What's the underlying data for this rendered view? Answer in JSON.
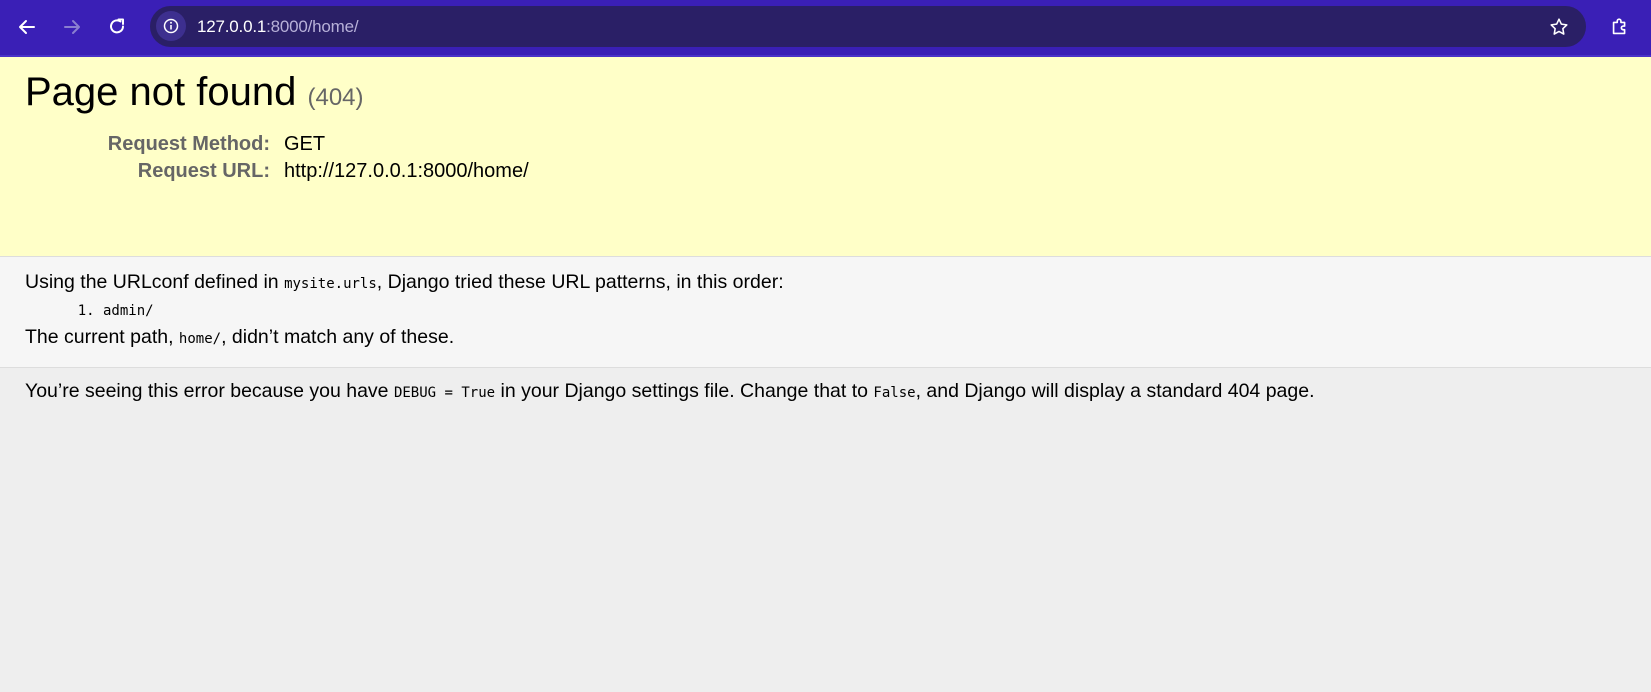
{
  "browser": {
    "url_host": "127.0.0.1",
    "url_path": ":8000/home/"
  },
  "summary": {
    "title": "Page not found",
    "code": "(404)",
    "rows": [
      {
        "label": "Request Method:",
        "value": "GET"
      },
      {
        "label": "Request URL:",
        "value": "http://127.0.0.1:8000/home/"
      }
    ]
  },
  "info": {
    "intro_pre": "Using the URLconf defined in ",
    "urlconf": "mysite.urls",
    "intro_post": ", Django tried these URL patterns, in this order:",
    "patterns": [
      "admin/"
    ],
    "path_pre": "The current path, ",
    "path": "home/",
    "path_post": ", didn’t match any of these."
  },
  "explanation": {
    "pre": "You’re seeing this error because you have ",
    "debug": "DEBUG = True",
    "mid": " in your Django settings file. Change that to ",
    "false": "False",
    "post": ", and Django will display a standard 404 page."
  },
  "colors": {
    "toolbar": "#3a1fb6",
    "omnibox": "#2a1f66",
    "summary_bg": "#ffffc8",
    "info_bg": "#f6f6f6",
    "page_bg": "#eeeeee"
  },
  "icons": [
    "back-arrow-icon",
    "forward-arrow-icon",
    "reload-icon",
    "info-icon",
    "star-icon",
    "extensions-icon"
  ]
}
